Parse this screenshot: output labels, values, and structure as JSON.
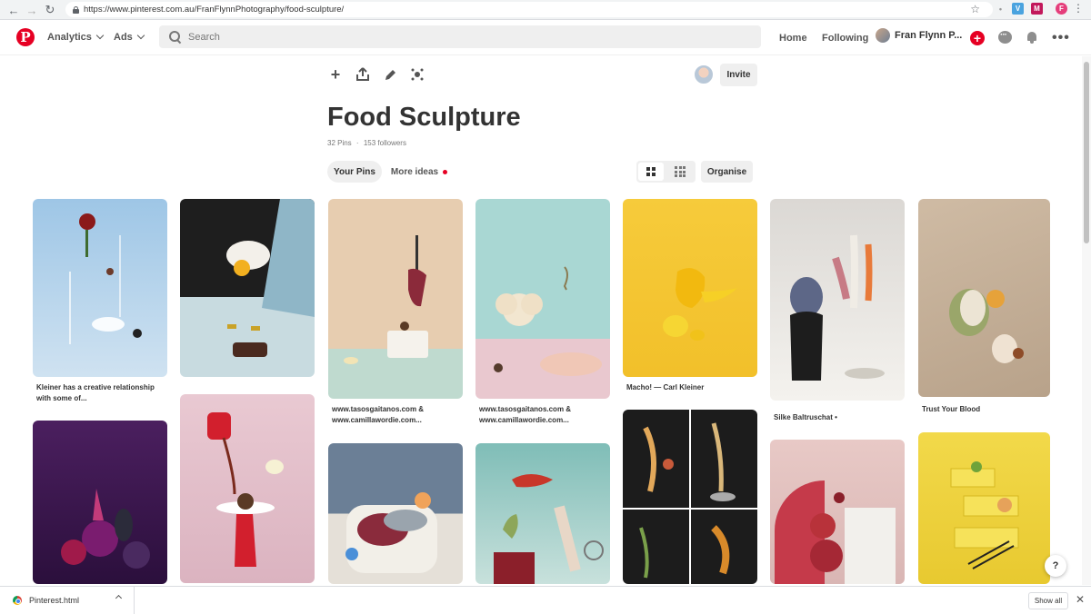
{
  "browser": {
    "url": "https://www.pinterest.com.au/FranFlynnPhotography/food-sculpture/",
    "profile_initial": "F",
    "ext_colors": [
      "#4aa3df",
      "#c2185b"
    ],
    "ext_labels": [
      "V",
      "M"
    ]
  },
  "header": {
    "logo": "P",
    "analytics_label": "Analytics",
    "ads_label": "Ads",
    "search_placeholder": "Search",
    "home_label": "Home",
    "following_label": "Following",
    "profile_name": "Fran Flynn P...",
    "brand_color": "#e60023"
  },
  "board": {
    "title": "Food Sculpture",
    "pins_count": "32 Pins",
    "separator": "·",
    "followers_count": "153 followers",
    "invite_label": "Invite",
    "tab_your_pins": "Your Pins",
    "tab_more_ideas": "More ideas",
    "organise_label": "Organise",
    "tools": [
      "add-icon",
      "share-icon",
      "edit-icon",
      "more-icon"
    ]
  },
  "pins": [
    {
      "caption": "Kleiner has a creative relationship with some of...",
      "colors": [
        "#9ec6e6",
        "#cfe2f1"
      ]
    },
    {
      "caption": "",
      "colors": [
        "#1e1e1e",
        "#c8dbe0"
      ]
    },
    {
      "caption": "www.tasosgaitanos.com & www.camillawordie.com...",
      "colors": [
        "#e7cdb0",
        "#bfdacf"
      ]
    },
    {
      "caption": "www.tasosgaitanos.com & www.camillawordie.com...",
      "colors": [
        "#a9d7d3",
        "#e9c8cf"
      ]
    },
    {
      "caption": "Macho! — Carl Kleiner",
      "colors": [
        "#f6cb3b",
        "#f2c02a"
      ]
    },
    {
      "caption": "Silke Baltruschat •",
      "colors": [
        "#dbd8d4",
        "#f4f2ee"
      ]
    },
    {
      "caption": "Trust Your Blood",
      "colors": [
        "#cfbba4",
        "#b8a28a"
      ]
    },
    {
      "caption": "",
      "colors": [
        "#4b1f5f",
        "#2b0f3c"
      ]
    },
    {
      "caption": "",
      "colors": [
        "#e9c9d2",
        "#dbb3c0"
      ]
    },
    {
      "caption": "",
      "colors": [
        "#6b7f96",
        "#e5e0d8"
      ]
    },
    {
      "caption": "",
      "colors": [
        "#7fbdb7",
        "#c8e1dc"
      ]
    },
    {
      "caption": "",
      "colors": [
        "#1c1c1c",
        "#3a2c22"
      ]
    },
    {
      "caption": "",
      "colors": [
        "#e8c9c6",
        "#d9b6b4"
      ]
    },
    {
      "caption": "",
      "colors": [
        "#f2d94a",
        "#e8c930"
      ]
    }
  ],
  "help_label": "?",
  "downloads": {
    "file_name": "Pinterest.html",
    "show_all_label": "Show all",
    "close_label": "✕"
  }
}
